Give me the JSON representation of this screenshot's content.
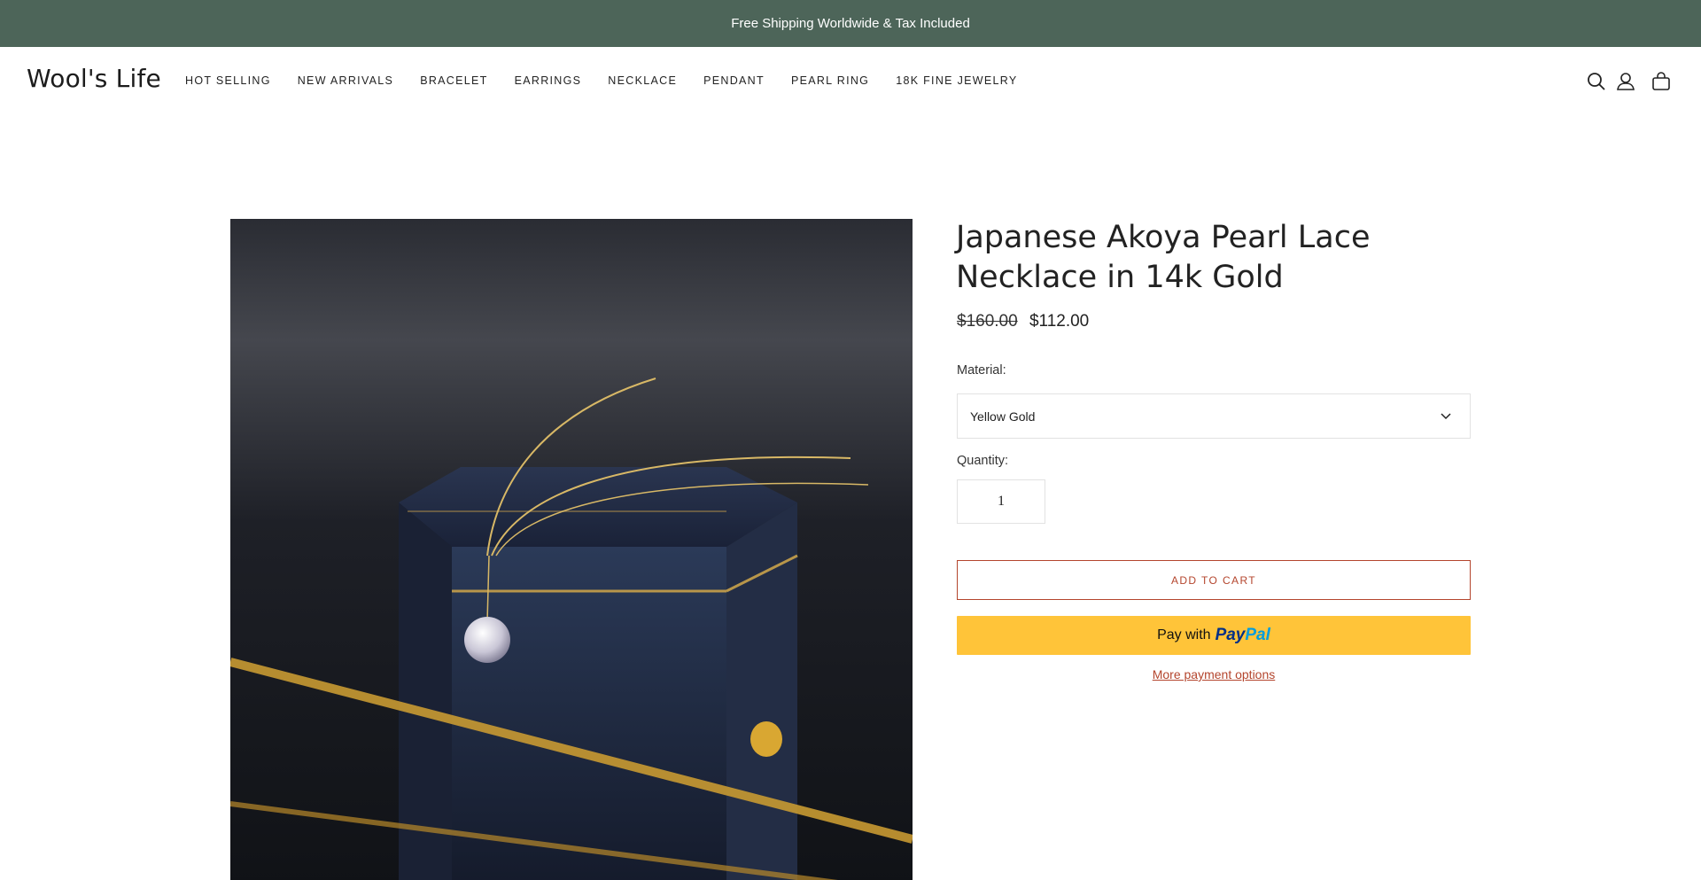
{
  "announcement": {
    "text": "Free Shipping Worldwide & Tax Included"
  },
  "header": {
    "logo": "Wool's Life",
    "nav": [
      {
        "label": "HOT SELLING"
      },
      {
        "label": "NEW ARRIVALS"
      },
      {
        "label": "BRACELET"
      },
      {
        "label": "EARRINGS"
      },
      {
        "label": "NECKLACE"
      },
      {
        "label": "PENDANT"
      },
      {
        "label": "PEARL RING"
      },
      {
        "label": "18K FINE JEWELRY"
      }
    ],
    "icons": [
      "search-icon",
      "account-icon",
      "cart-icon"
    ]
  },
  "product": {
    "title": "Japanese Akoya Pearl Lace Necklace in 14k Gold",
    "price_original": "$160.00",
    "price_sale": "$112.00",
    "material_label": "Material:",
    "material_value": "Yellow Gold",
    "quantity_label": "Quantity:",
    "quantity_value": "1",
    "add_to_cart": "ADD TO CART",
    "paypal_prefix": "Pay with",
    "paypal_brand_a": "Pay",
    "paypal_brand_b": "Pal",
    "more_payment": "More payment options"
  },
  "colors": {
    "announcement_bg": "#4d6559",
    "accent": "#b4452d",
    "paypal_yellow": "#ffc439"
  }
}
